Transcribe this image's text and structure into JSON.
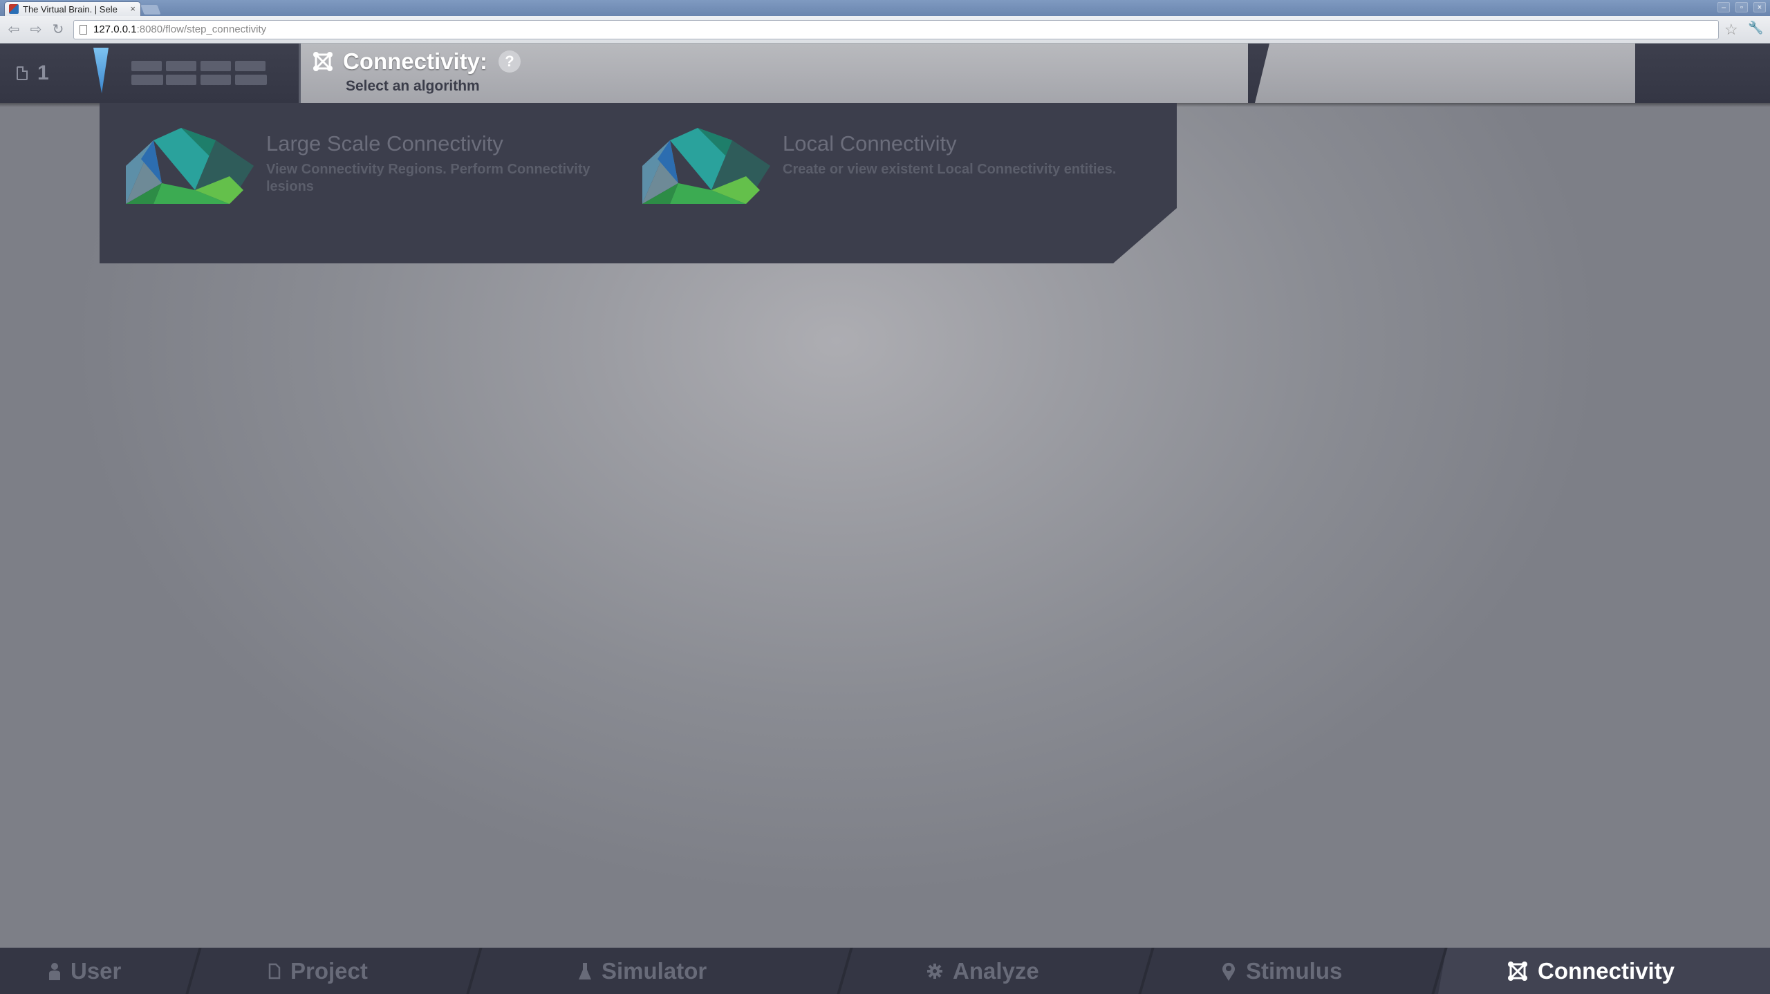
{
  "browser": {
    "tab_title": "The Virtual Brain. | Selе",
    "tab_close": "×",
    "url_host": "127.0.0.1",
    "url_path": ":8080/flow/step_connectivity"
  },
  "header": {
    "project_count": "1",
    "title": "Connectivity:",
    "help": "?",
    "subtitle": "Select an algorithm"
  },
  "algorithms": [
    {
      "title": "Large Scale Connectivity",
      "description": "View Connectivity Regions. Perform Connectivity lesions"
    },
    {
      "title": "Local Connectivity",
      "description": "Create or view existent Local Connectivity entities."
    }
  ],
  "bottom_nav": [
    {
      "label": "User",
      "icon": "user-icon"
    },
    {
      "label": "Project",
      "icon": "document-icon"
    },
    {
      "label": "Simulator",
      "icon": "flask-icon"
    },
    {
      "label": "Analyze",
      "icon": "gear-icon"
    },
    {
      "label": "Stimulus",
      "icon": "pin-icon"
    },
    {
      "label": "Connectivity",
      "icon": "connectivity-icon",
      "active": true
    }
  ],
  "colors": {
    "header_dark": "#3c3e4c",
    "nav_text": "#686b79",
    "active_text": "#ffffff"
  }
}
